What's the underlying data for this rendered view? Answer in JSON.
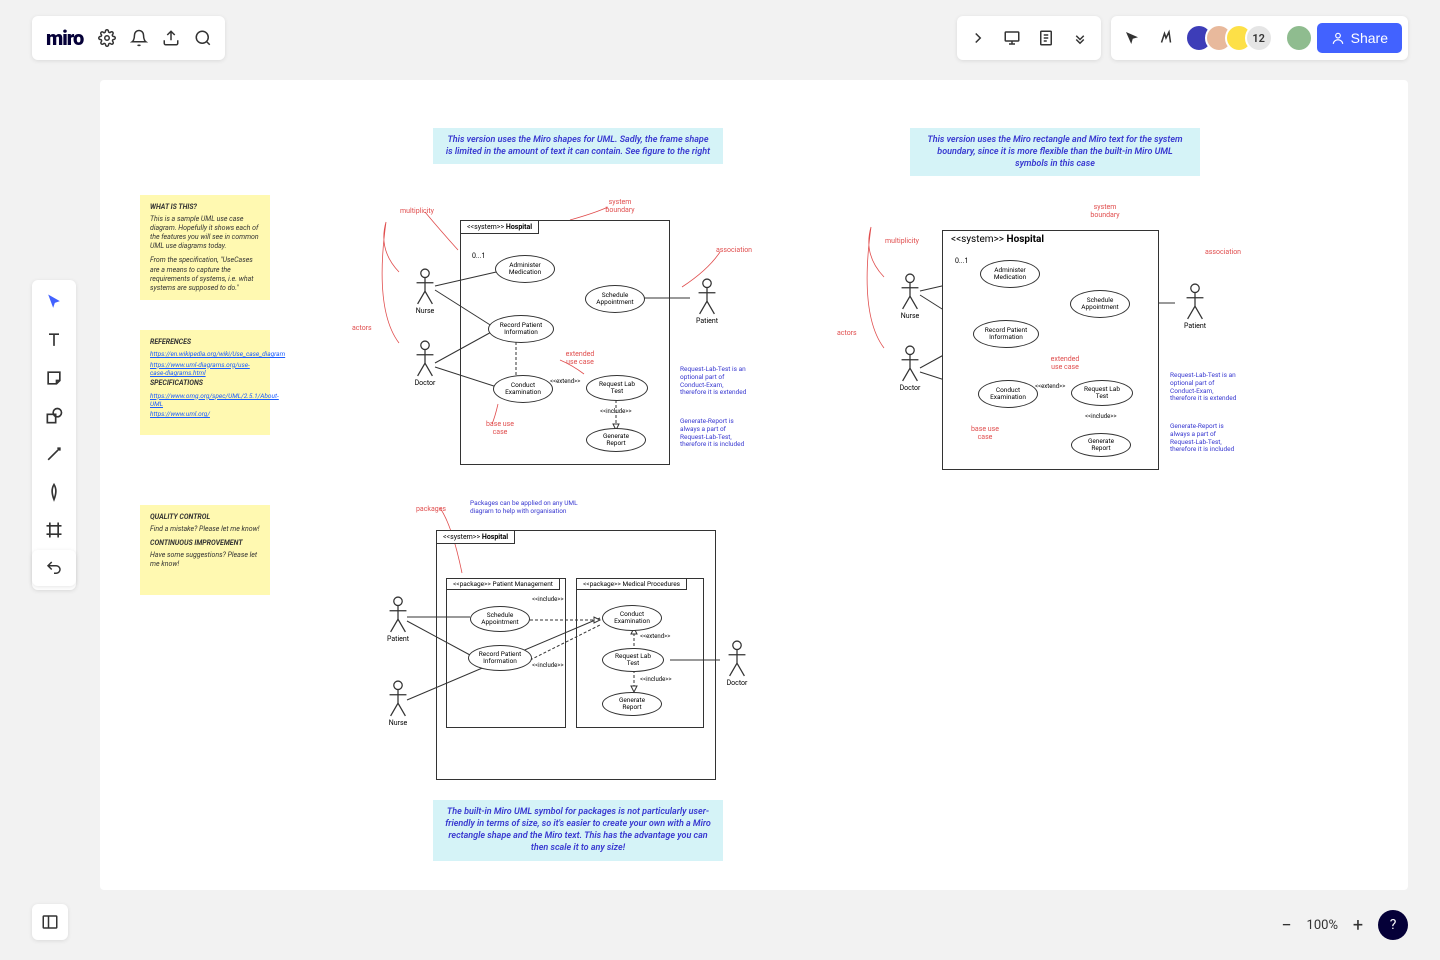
{
  "app": {
    "name": "miro"
  },
  "collab": {
    "count": "12",
    "share_label": "Share"
  },
  "zoom": {
    "level": "100%"
  },
  "descriptions": {
    "top_left": "This version uses the Miro shapes for UML. Sadly, the frame shape is limited in the amount of text it can contain. See figure to the right",
    "top_right": "This version uses the Miro rectangle and Miro text for the system boundary, since it is more flexible than the built-in Miro UML symbols in this case",
    "bottom": "The built-in Miro UML symbol for packages is not particularly user-friendly in terms of size, so it's easier to create your own with a Miro rectangle shape and the Miro text. This has the advantage you can then scale it to any size!"
  },
  "sticky1": {
    "h1": "WHAT IS THIS?",
    "p1": "This is a sample UML use case diagram. Hopefully it shows each of the features you will see in common UML use diagrams today.",
    "p2": "From the specification, \"UseCases are a means to capture the requirements of systems, i.e. what systems are supposed to do.\""
  },
  "sticky2": {
    "h1": "REFERENCES",
    "l1": "https://en.wikipedia.org/wiki/Use_case_diagram",
    "l2": "https://www.uml-diagrams.org/use-case-diagrams.html",
    "h2": "SPECIFICATIONS",
    "l3": "https://www.omg.org/spec/UML/2.5.1/About-UML",
    "l4": "https://www.uml.org/"
  },
  "sticky3": {
    "h1": "QUALITY CONTROL",
    "p1": "Find a mistake? Please let me know!",
    "h2": "CONTINUOUS IMPROVEMENT",
    "p2": "Have some suggestions? Please let me know!"
  },
  "diagram": {
    "system_label_prefix": "<<system>>",
    "system_label": "Hospital",
    "actors": {
      "nurse": "Nurse",
      "doctor": "Doctor",
      "patient": "Patient"
    },
    "usecases": {
      "administer": "Administer Medication",
      "schedule": "Schedule Appointment",
      "record": "Record Patient Information",
      "conduct": "Conduct Examination",
      "request": "Request Lab Test",
      "generate": "Generate Report"
    },
    "stereotypes": {
      "extend": "<<extend>>",
      "include": "<<include>>"
    },
    "notes": {
      "request_ext": "Request-Lab-Test is an optional part of Conduct-Exam, therefore it is extended",
      "generate_inc": "Generate-Report is always a part of Request-Lab-Test, therefore it is included"
    },
    "annotations": {
      "system_boundary": "system boundary",
      "multiplicity": "multiplicity",
      "actors": "actors",
      "association": "association",
      "extended_uc": "extended use case",
      "base_uc": "base use case",
      "packages": "packages",
      "packages_note": "Packages can be applied on any UML diagram to help with organisation"
    },
    "mult": "0...1"
  },
  "packages": {
    "pm": "<<package>> Patient Management",
    "mp": "<<package>> Medical Procedures"
  }
}
